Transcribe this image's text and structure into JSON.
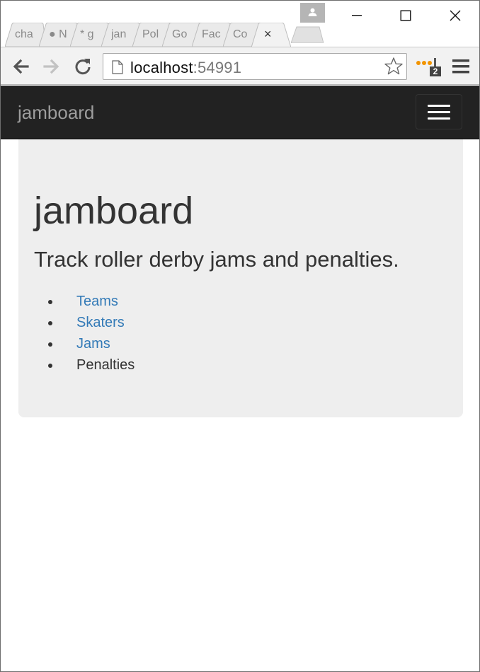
{
  "browser": {
    "tabs": [
      {
        "title": "cha",
        "active": false
      },
      {
        "title": "● N",
        "active": false
      },
      {
        "title": "* g",
        "active": false
      },
      {
        "title": "jan",
        "active": false
      },
      {
        "title": "Pol",
        "active": false
      },
      {
        "title": "Go",
        "active": false
      },
      {
        "title": "Fac",
        "active": false
      },
      {
        "title": "Co",
        "active": false
      },
      {
        "title": "",
        "active": true
      }
    ],
    "active_tab_close": "×",
    "url_host": "localhost",
    "url_port": ":54991",
    "extension_badge": "2",
    "icons": [
      "profile-icon",
      "minimize-icon",
      "maximize-icon",
      "close-window-icon",
      "back-icon",
      "forward-icon",
      "reload-icon",
      "page-icon",
      "star-icon",
      "extension-icon",
      "menu-icon"
    ]
  },
  "page": {
    "brand": "jamboard",
    "heading": "jamboard",
    "lead": "Track roller derby jams and penalties.",
    "links": [
      {
        "label": "Teams",
        "is_link": true
      },
      {
        "label": "Skaters",
        "is_link": true
      },
      {
        "label": "Jams",
        "is_link": true
      },
      {
        "label": "Penalties",
        "is_link": false
      }
    ]
  },
  "colors": {
    "navbar": "#222222",
    "jumbotron": "#eeeeee",
    "link": "#337ab7",
    "text": "#333333"
  }
}
